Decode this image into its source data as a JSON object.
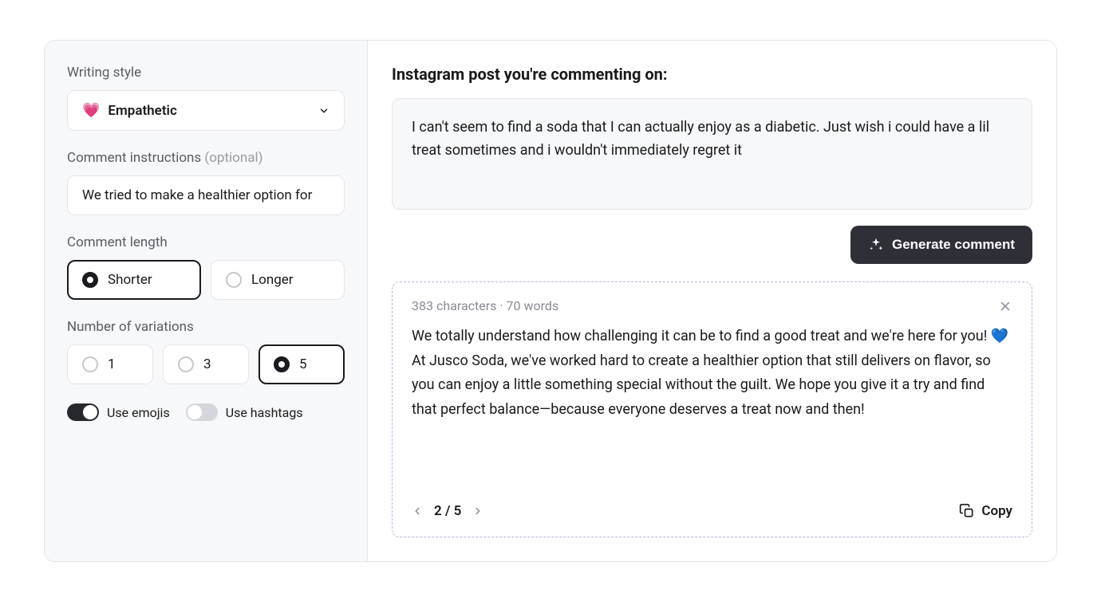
{
  "sidebar": {
    "writing_style_label": "Writing style",
    "writing_style_emoji": "💗",
    "writing_style_value": "Empathetic",
    "instructions_label": "Comment instructions ",
    "instructions_optional": "(optional)",
    "instructions_value": "We tried to make a healthier option for",
    "length_label": "Comment length",
    "length_options": [
      "Shorter",
      "Longer"
    ],
    "length_selected": "Shorter",
    "variations_label": "Number of variations",
    "variations_options": [
      "1",
      "3",
      "5"
    ],
    "variations_selected": "5",
    "emojis_label": "Use emojis",
    "emojis_on": true,
    "hashtags_label": "Use hashtags",
    "hashtags_on": false
  },
  "main": {
    "heading": "Instagram post you're commenting on:",
    "post_text": "I can't seem to find a soda that I can actually enjoy as a diabetic. Just wish i could have a lil treat sometimes and i wouldn't immediately regret it",
    "generate_label": "Generate comment",
    "result_meta": "383 characters · 70 words",
    "result_text": "We totally understand how challenging it can be to find a good treat and we're here for you! 💙 At Jusco Soda, we've worked hard to create a healthier option that still delivers on flavor, so you can enjoy a little something special without the guilt. We hope you give it a try and find that perfect balance—because everyone deserves a treat now and then!",
    "pager_current": "2",
    "pager_sep": " / ",
    "pager_total": "5",
    "copy_label": "Copy"
  }
}
